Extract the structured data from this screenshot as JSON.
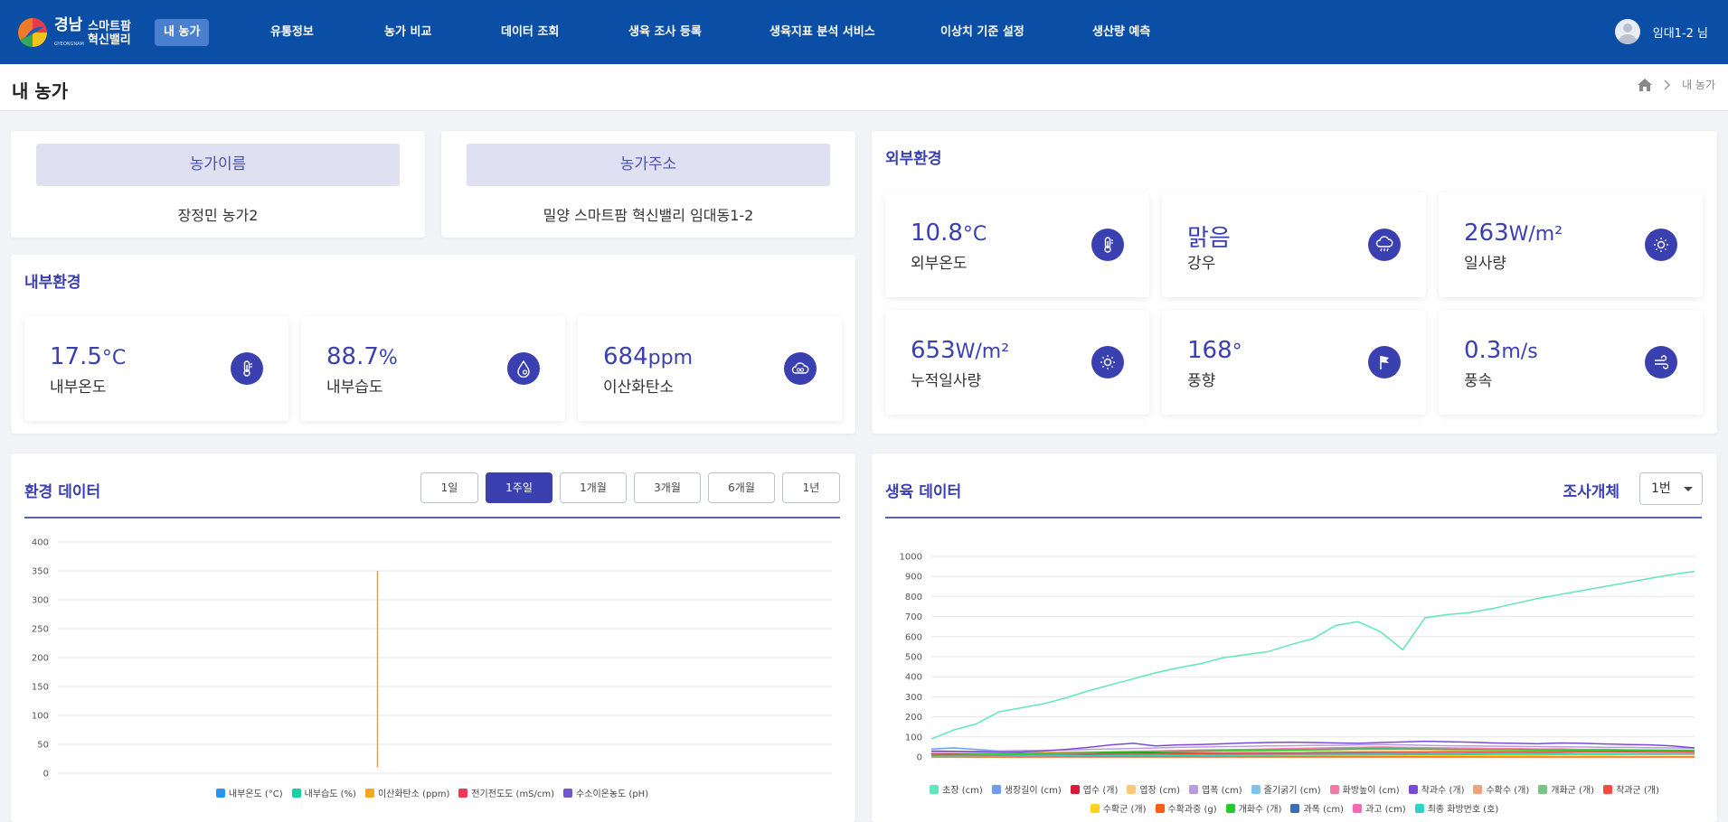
{
  "brand": {
    "line1": "경남",
    "line2": "스마트팜",
    "line3": "혁신밸리",
    "sub": "GYEONGNAM"
  },
  "nav": [
    {
      "label": "내 농가",
      "active": true
    },
    {
      "label": "유통정보"
    },
    {
      "label": "농가 비교"
    },
    {
      "label": "데이터 조회"
    },
    {
      "label": "생육 조사 등록"
    },
    {
      "label": "생육지표 분석 서비스"
    },
    {
      "label": "이상치 기준 설정"
    },
    {
      "label": "생산량 예측"
    }
  ],
  "user": {
    "name": "임대1-2 님"
  },
  "page": {
    "title": "내 농가",
    "breadcrumb": "내 농가"
  },
  "farm": {
    "name_header": "농가이름",
    "name_value": "장정민 농가2",
    "addr_header": "농가주소",
    "addr_value": "밀양 스마트팜 혁신밸리 임대동1-2"
  },
  "internal": {
    "title": "내부환경",
    "stats": [
      {
        "value": "17.5",
        "unit": "°C",
        "label": "내부온도",
        "icon": "thermometer-icon"
      },
      {
        "value": "88.7",
        "unit": "%",
        "label": "내부습도",
        "icon": "humidity-drop-icon"
      },
      {
        "value": "684",
        "unit": "ppm",
        "label": "이산화탄소",
        "icon": "cloud-co2-icon"
      }
    ]
  },
  "external": {
    "title": "외부환경",
    "stats": [
      {
        "value": "10.8",
        "unit": "°C",
        "label": "외부온도",
        "icon": "thermometer-icon"
      },
      {
        "value": "맑음",
        "unit": "",
        "label": "강우",
        "icon": "rain-cloud-icon"
      },
      {
        "value": "263",
        "unit": "W/m²",
        "label": "일사량",
        "icon": "sun-icon"
      },
      {
        "value": "653",
        "unit": "W/m²",
        "label": "누적일사량",
        "icon": "sun-icon"
      },
      {
        "value": "168",
        "unit": "°",
        "label": "풍향",
        "icon": "wind-flag-icon"
      },
      {
        "value": "0.3",
        "unit": "m/s",
        "label": "풍속",
        "icon": "wind-icon"
      }
    ]
  },
  "env_chart": {
    "title": "환경 데이터",
    "ranges": [
      {
        "label": "1일"
      },
      {
        "label": "1주일",
        "selected": true
      },
      {
        "label": "1개월"
      },
      {
        "label": "3개월"
      },
      {
        "label": "6개월"
      },
      {
        "label": "1년"
      }
    ]
  },
  "growth_chart": {
    "title": "생육 데이터",
    "subject_label": "조사개체",
    "subject_value": "1번"
  },
  "chart_data": [
    {
      "type": "line",
      "ylim": [
        0,
        400
      ],
      "yticks": [
        0,
        50,
        100,
        150,
        200,
        250,
        300,
        350,
        400
      ],
      "series": [
        {
          "name": "내부온도 (°C)",
          "color": "#2196f3",
          "values": []
        },
        {
          "name": "내부습도 (%)",
          "color": "#1ad0a0",
          "values": []
        },
        {
          "name": "이산화탄소 (ppm)",
          "color": "#f5a623",
          "values": [
            10,
            350,
            10
          ]
        },
        {
          "name": "전기전도도 (mS/cm)",
          "color": "#f0375a",
          "values": []
        },
        {
          "name": "수소이온농도 (pH)",
          "color": "#7356c8",
          "values": []
        }
      ]
    },
    {
      "type": "line",
      "ylim": [
        0,
        1000
      ],
      "yticks": [
        0,
        100,
        200,
        300,
        400,
        500,
        600,
        700,
        800,
        900,
        1000
      ],
      "series": [
        {
          "name": "초장 (cm)",
          "color": "#5ee8b9",
          "values": [
            90,
            135,
            165,
            225,
            245,
            265,
            295,
            330,
            360,
            390,
            420,
            445,
            465,
            495,
            510,
            525,
            560,
            590,
            655,
            675,
            625,
            535,
            695,
            710,
            720,
            740,
            765,
            790,
            810,
            830,
            850,
            870,
            890,
            910,
            925
          ]
        },
        {
          "name": "생장길이 (cm)",
          "color": "#6f9cf0",
          "values": [
            40,
            45,
            38,
            30,
            25,
            22,
            20,
            22,
            24,
            26,
            28,
            30,
            32,
            34,
            35,
            36,
            38,
            40,
            42,
            44,
            46,
            44,
            42,
            40,
            38,
            36,
            35,
            34,
            33,
            32,
            31,
            30,
            30,
            30,
            30
          ]
        },
        {
          "name": "엽수 (개)",
          "color": "#d81b3c",
          "values": [
            15,
            15,
            16,
            16,
            17,
            17,
            18,
            18,
            18,
            19,
            19,
            20,
            20,
            20,
            21,
            21,
            21,
            22,
            22,
            22,
            23,
            23,
            23,
            24,
            24,
            24,
            25,
            25,
            25,
            26,
            26,
            26,
            27,
            27,
            27
          ]
        },
        {
          "name": "엽장 (cm)",
          "color": "#ffc875",
          "values": [
            20,
            22,
            23,
            24,
            25,
            25,
            26,
            26,
            27,
            27,
            28,
            28,
            28,
            29,
            29,
            29,
            30,
            30,
            30,
            31,
            31,
            31,
            31,
            32,
            32,
            32,
            32,
            33,
            33,
            33,
            33,
            33,
            34,
            34,
            34
          ]
        },
        {
          "name": "엽폭 (cm)",
          "color": "#b99ce0",
          "values": [
            25,
            27,
            28,
            30,
            32,
            33,
            35,
            38,
            40,
            42,
            45,
            48,
            50,
            52,
            53,
            55,
            56,
            58,
            58,
            60,
            62,
            60,
            58,
            56,
            55,
            54,
            53,
            52,
            50,
            50,
            48,
            48,
            46,
            45,
            44
          ]
        },
        {
          "name": "줄기굵기 (cm)",
          "color": "#7fc4f0",
          "values": [
            10,
            10,
            11,
            11,
            11,
            12,
            12,
            12,
            12,
            13,
            13,
            13,
            13,
            14,
            14,
            14,
            14,
            15,
            15,
            15,
            15,
            15,
            16,
            16,
            16,
            16,
            16,
            17,
            17,
            17,
            17,
            17,
            17,
            18,
            18
          ]
        },
        {
          "name": "화방높이 (cm)",
          "color": "#f27aa3",
          "values": [
            5,
            8,
            10,
            12,
            15,
            18,
            20,
            22,
            25,
            28,
            30,
            32,
            35,
            36,
            38,
            40,
            42,
            44,
            46,
            48,
            50,
            48,
            46,
            45,
            44,
            43,
            42,
            40,
            40,
            38,
            38,
            36,
            35,
            34,
            33
          ]
        },
        {
          "name": "착과수 (개)",
          "color": "#7a4bd8",
          "values": [
            30,
            28,
            26,
            25,
            25,
            30,
            38,
            48,
            60,
            68,
            55,
            60,
            62,
            66,
            70,
            72,
            74,
            72,
            70,
            68,
            72,
            75,
            78,
            76,
            74,
            70,
            68,
            66,
            70,
            68,
            65,
            62,
            60,
            55,
            45
          ]
        },
        {
          "name": "수확수 (개)",
          "color": "#f5a07a",
          "values": [
            0,
            0,
            0,
            0,
            0,
            1,
            1,
            2,
            2,
            3,
            3,
            4,
            4,
            5,
            5,
            6,
            6,
            7,
            7,
            8,
            8,
            9,
            9,
            10,
            10,
            11,
            11,
            12,
            12,
            13,
            13,
            14,
            14,
            15,
            15
          ]
        },
        {
          "name": "개화군 (개)",
          "color": "#7cc285",
          "values": [
            5,
            6,
            7,
            8,
            9,
            10,
            11,
            12,
            13,
            14,
            15,
            16,
            17,
            18,
            19,
            20,
            21,
            22,
            23,
            24,
            25,
            25,
            25,
            26,
            26,
            26,
            27,
            27,
            27,
            28,
            28,
            28,
            28,
            29,
            29
          ]
        },
        {
          "name": "착과군 (개)",
          "color": "#f04e3a",
          "values": [
            3,
            4,
            5,
            6,
            7,
            8,
            9,
            10,
            11,
            12,
            13,
            14,
            15,
            16,
            17,
            18,
            19,
            20,
            21,
            22,
            22,
            23,
            23,
            24,
            24,
            25,
            25,
            25,
            26,
            26,
            26,
            27,
            27,
            27,
            27
          ]
        },
        {
          "name": "수확군 (개)",
          "color": "#ffd21a",
          "values": [
            0,
            0,
            0,
            0,
            1,
            1,
            1,
            2,
            2,
            2,
            3,
            3,
            3,
            4,
            4,
            4,
            5,
            5,
            5,
            6,
            6,
            6,
            7,
            7,
            7,
            8,
            8,
            8,
            9,
            9,
            9,
            10,
            10,
            10,
            10
          ]
        },
        {
          "name": "수확과중 (g)",
          "color": "#ff5a1a",
          "values": [
            0,
            0,
            0,
            0,
            0,
            0,
            0,
            0,
            0,
            0,
            0,
            0,
            0,
            0,
            0,
            0,
            0,
            0,
            0,
            0,
            0,
            0,
            0,
            0,
            0,
            0,
            0,
            0,
            0,
            0,
            0,
            0,
            0,
            0,
            0
          ]
        },
        {
          "name": "개화수 (개)",
          "color": "#27c92c",
          "values": [
            10,
            12,
            14,
            15,
            16,
            18,
            20,
            22,
            24,
            25,
            26,
            28,
            30,
            32,
            33,
            34,
            35,
            36,
            38,
            40,
            40,
            40,
            39,
            38,
            37,
            36,
            36,
            35,
            35,
            34,
            34,
            33,
            33,
            32,
            32
          ]
        },
        {
          "name": "과폭 (cm)",
          "color": "#3a6fb8",
          "values": [
            1,
            2,
            3,
            4,
            5,
            6,
            7,
            8,
            8,
            9,
            9,
            10,
            10,
            11,
            11,
            12,
            12,
            12,
            13,
            13,
            13,
            14,
            14,
            14,
            15,
            15,
            15,
            15,
            16,
            16,
            16,
            16,
            16,
            17,
            17
          ]
        },
        {
          "name": "과고 (cm)",
          "color": "#f569b8",
          "values": [
            1,
            2,
            3,
            4,
            5,
            6,
            7,
            7,
            8,
            8,
            9,
            9,
            10,
            10,
            10,
            11,
            11,
            11,
            12,
            12,
            12,
            13,
            13,
            13,
            13,
            14,
            14,
            14,
            14,
            15,
            15,
            15,
            15,
            15,
            16
          ]
        },
        {
          "name": "최종 화방번호 (호)",
          "color": "#27d6c8",
          "values": [
            2,
            2,
            3,
            3,
            4,
            4,
            5,
            5,
            6,
            6,
            7,
            7,
            8,
            8,
            9,
            9,
            10,
            10,
            11,
            11,
            12,
            12,
            13,
            13,
            14,
            14,
            15,
            15,
            16,
            16,
            17,
            17,
            18,
            18,
            19
          ]
        }
      ]
    }
  ],
  "colors": {
    "nav_bg": "#0a4ea6",
    "accent": "#3a40b0",
    "info_header_bg": "#dfe1f3"
  }
}
